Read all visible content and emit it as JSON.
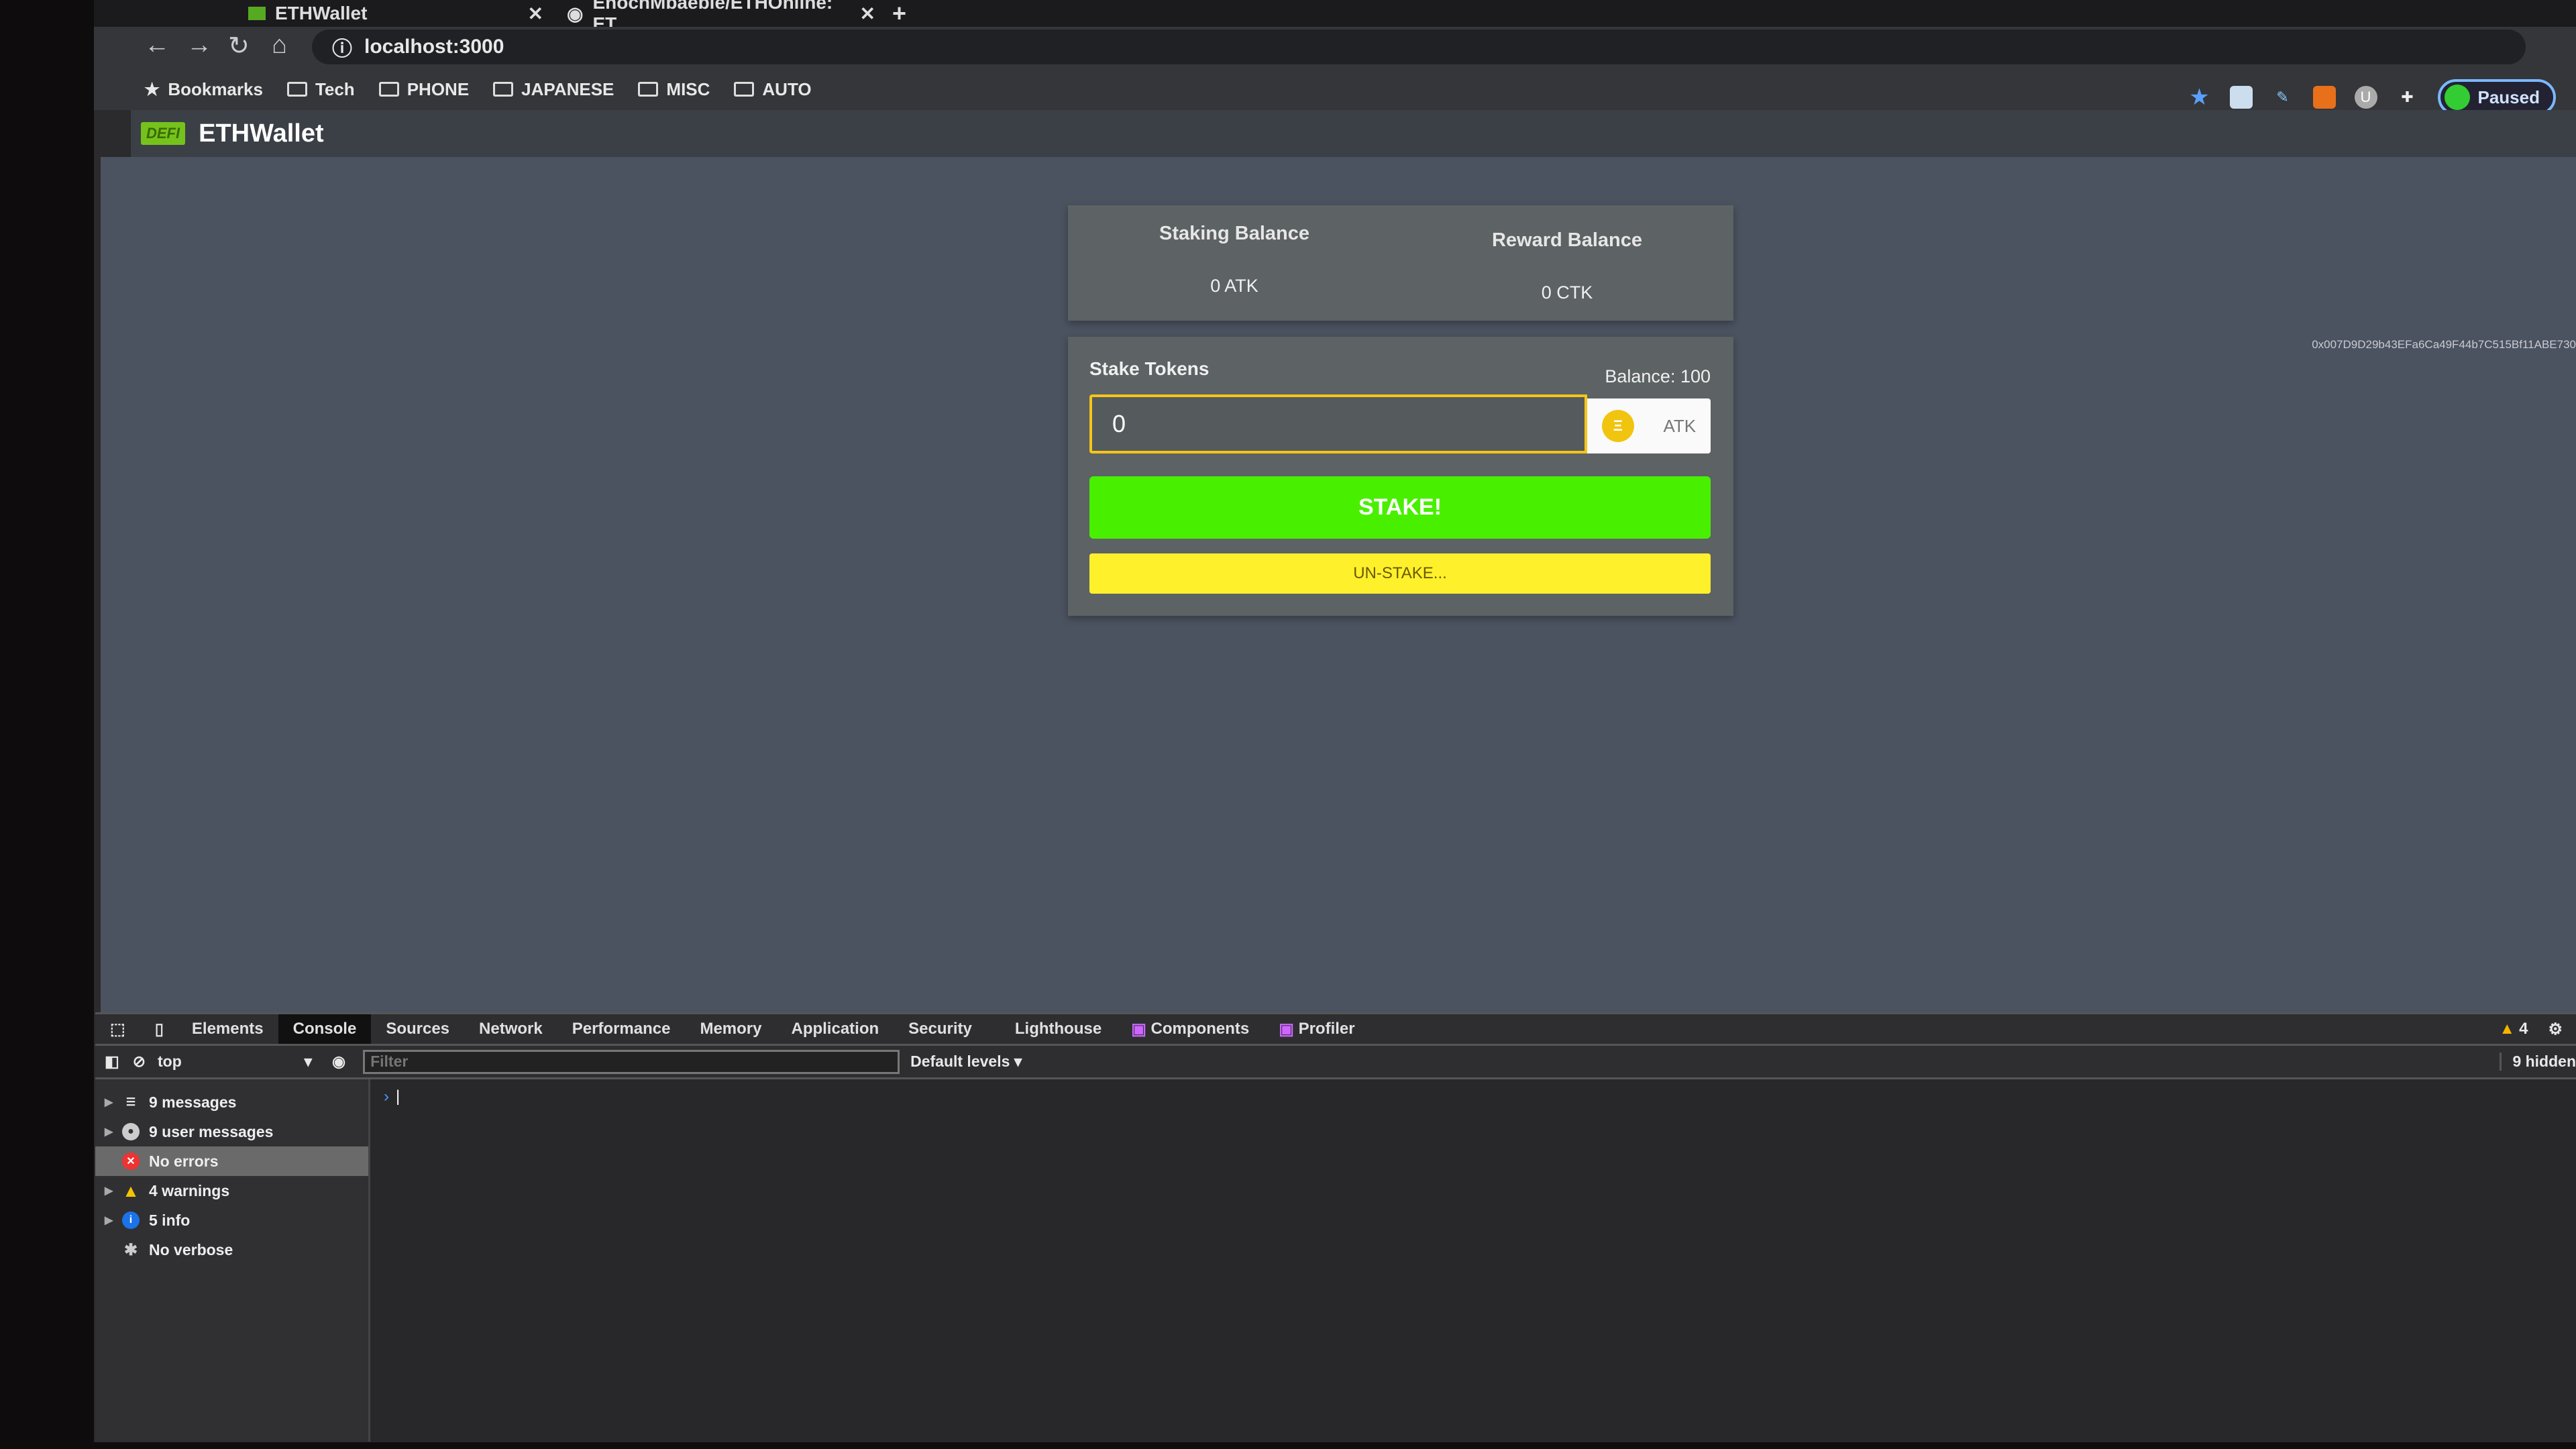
{
  "browser": {
    "tabs": [
      {
        "label": "ETHWallet"
      },
      {
        "label": "EnochMbaebie/ETHOnline: ET"
      }
    ],
    "url": "localhost:3000",
    "bookmarks": [
      "Bookmarks",
      "Tech",
      "PHONE",
      "JAPANESE",
      "MISC",
      "AUTO"
    ],
    "profile_status": "Paused",
    "extensions": [
      "star-icon",
      "screen-icon",
      "pen-icon",
      "metamask-fox-icon",
      "u-icon",
      "puzzle-icon"
    ]
  },
  "app": {
    "logo_text": "DEFI",
    "brand": "ETHWallet",
    "account": "0x007D9D29b43EFa6Ca49F44b7C515Bf11ABE730",
    "balances": {
      "staking_label": "Staking Balance",
      "staking_value": "0 ATK",
      "reward_label": "Reward Balance",
      "reward_value": "0 CTK"
    },
    "stake": {
      "title": "Stake Tokens",
      "balance": "Balance: 100",
      "amount": "0",
      "token": "ATK",
      "stake_label": "STAKE!",
      "unstake_label": "UN-STAKE..."
    },
    "colors": {
      "stake": "#48f000",
      "unstake": "#fff02c",
      "input_border": "#f5c518"
    }
  },
  "devtools": {
    "tabs": [
      "Elements",
      "Console",
      "Sources",
      "Network",
      "Performance",
      "Memory",
      "Application",
      "Security",
      "Lighthouse",
      "Components",
      "Profiler"
    ],
    "active_tab": "Console",
    "context": "top",
    "filter_placeholder": "Filter",
    "levels": "Default levels",
    "warnings_badge": "4",
    "hidden": "9 hidden",
    "sidebar": [
      "9 messages",
      "9 user messages",
      "No errors",
      "4 warnings",
      "5 info",
      "No verbose"
    ]
  }
}
